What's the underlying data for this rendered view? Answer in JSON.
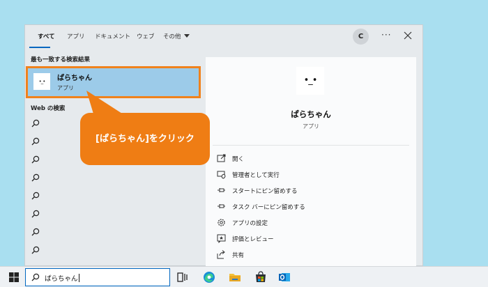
{
  "tabs": [
    "すべて",
    "アプリ",
    "ドキュメント",
    "ウェブ",
    "その他"
  ],
  "avatar_letter": "C",
  "best_match": {
    "section_label": "最も一致する検索結果",
    "title": "ぱらちゃん",
    "subtitle": "アプリ",
    "icon_face": "•_•"
  },
  "web_section_label": "Web の検索",
  "web_rows": 8,
  "detail": {
    "title": "ぱらちゃん",
    "subtitle": "アプリ",
    "icon_face": "•_•",
    "actions": [
      "開く",
      "管理者として実行",
      "スタートにピン留めする",
      "タスク バーにピン留めする",
      "アプリの設定",
      "評価とレビュー",
      "共有"
    ]
  },
  "callout_text": "[ぱらちゃん]をクリック",
  "taskbar": {
    "search_value": "ぱらちゃん",
    "apps": [
      "task-view-icon",
      "edge-icon",
      "file-explorer-icon",
      "store-icon",
      "outlook-icon"
    ]
  },
  "colors": {
    "highlight": "#9ccbe9",
    "callout": "#ef7d14",
    "accent": "#0067c0"
  }
}
